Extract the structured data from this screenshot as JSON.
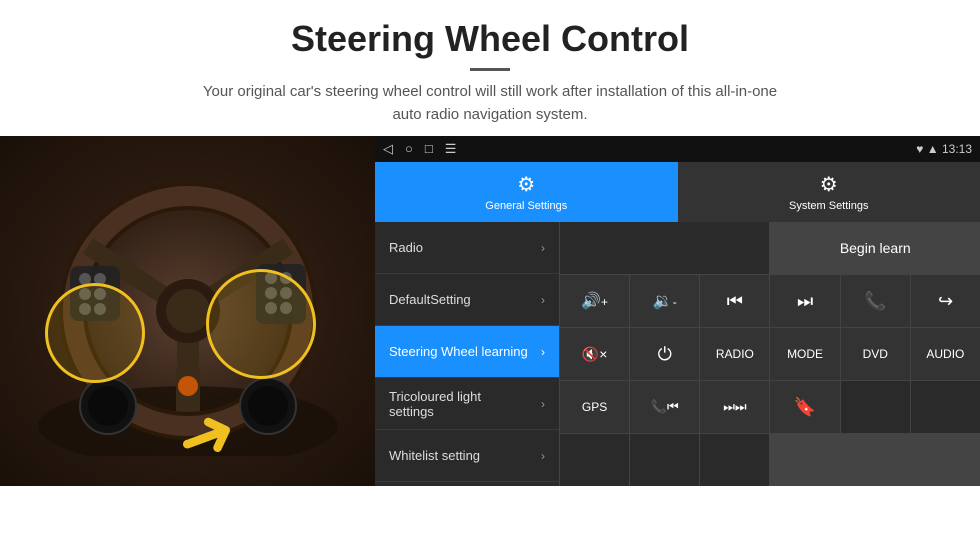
{
  "page": {
    "title": "Steering Wheel Control",
    "divider": true,
    "subtitle": "Your original car's steering wheel control will still work after installation of this all-in-one\nauto radio navigation system."
  },
  "status_bar": {
    "nav_icons": [
      "◁",
      "○",
      "□",
      "☰"
    ],
    "right_icons": "♥  ▲  13:13"
  },
  "tabs": [
    {
      "id": "general",
      "label": "General Settings",
      "icon": "⚙",
      "active": true
    },
    {
      "id": "system",
      "label": "System Settings",
      "icon": "⚙",
      "active": false
    }
  ],
  "menu_items": [
    {
      "id": "radio",
      "label": "Radio",
      "active": false
    },
    {
      "id": "default",
      "label": "DefaultSetting",
      "active": false
    },
    {
      "id": "steering",
      "label": "Steering Wheel learning",
      "active": true
    },
    {
      "id": "tricoloured",
      "label": "Tricoloured light settings",
      "active": false
    },
    {
      "id": "whitelist",
      "label": "Whitelist setting",
      "active": false
    }
  ],
  "control_buttons": {
    "begin_learn": "Begin learn",
    "row2": [
      {
        "id": "vol_up",
        "icon": "🔊+",
        "label": "vol-up"
      },
      {
        "id": "vol_down",
        "icon": "🔉-",
        "label": "vol-down"
      },
      {
        "id": "prev",
        "icon": "⏮",
        "label": "prev"
      },
      {
        "id": "next",
        "icon": "⏭",
        "label": "next"
      },
      {
        "id": "phone",
        "icon": "📞",
        "label": "phone"
      }
    ],
    "row3": [
      {
        "id": "hangup",
        "icon": "↩",
        "label": "hangup"
      },
      {
        "id": "mute",
        "icon": "🔇×",
        "label": "mute"
      },
      {
        "id": "power",
        "icon": "⏻",
        "label": "power"
      },
      {
        "id": "radio",
        "label": "RADIO"
      },
      {
        "id": "mode",
        "label": "MODE"
      }
    ],
    "row4": [
      {
        "id": "dvd",
        "label": "DVD"
      },
      {
        "id": "audio",
        "label": "AUDIO"
      },
      {
        "id": "gps",
        "label": "GPS"
      },
      {
        "id": "phone_prev",
        "icon": "📞⏮",
        "label": "phone-prev"
      },
      {
        "id": "skip_next",
        "icon": "⏭⏭",
        "label": "skip-next"
      }
    ],
    "row5": [
      {
        "id": "bookmark",
        "icon": "🔖",
        "label": "bookmark"
      }
    ]
  }
}
